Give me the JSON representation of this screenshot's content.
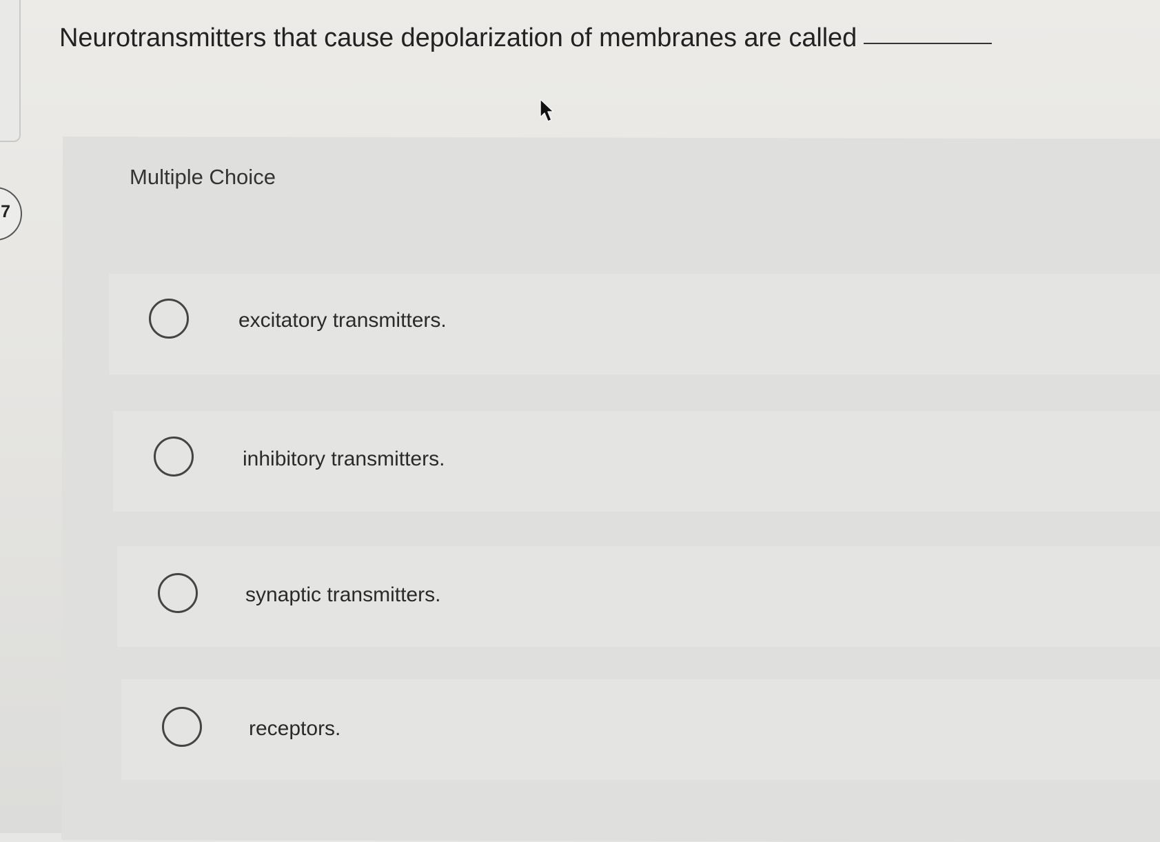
{
  "question": {
    "number": "7",
    "text": "Neurotransmitters that cause depolarization of membranes are called"
  },
  "panel": {
    "label": "Multiple Choice"
  },
  "options": [
    {
      "label": "excitatory transmitters."
    },
    {
      "label": "inhibitory transmitters."
    },
    {
      "label": "synaptic transmitters."
    },
    {
      "label": "receptors."
    }
  ],
  "icons": {
    "cursor": "arrow-cursor-icon",
    "radio": "radio-unselected-icon"
  },
  "colors": {
    "background": "#e7e7e5",
    "panel": "#dfdfdd",
    "text": "#2b2b2b",
    "radio_border": "#444444"
  }
}
